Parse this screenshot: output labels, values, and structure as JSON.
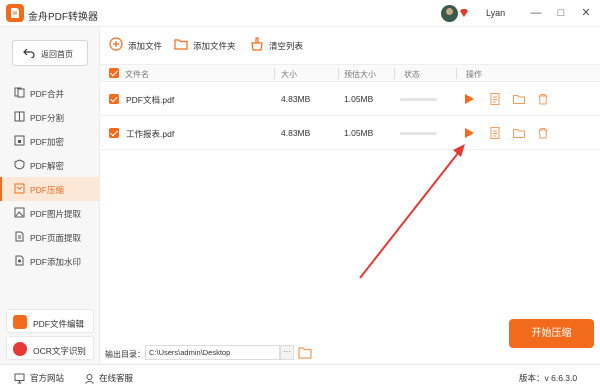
{
  "app": {
    "title": "金舟PDF转换器",
    "brand_color": "#f26b1d"
  },
  "user": {
    "name": "Lyan"
  },
  "window_buttons": [
    "—",
    "□",
    "✕"
  ],
  "sidebar": {
    "home_label": "返回首页",
    "items": [
      {
        "label": "PDF合并",
        "icon": "merge-icon"
      },
      {
        "label": "PDF分割",
        "icon": "split-icon"
      },
      {
        "label": "PDF加密",
        "icon": "lock-icon"
      },
      {
        "label": "PDF解密",
        "icon": "unlock-icon"
      },
      {
        "label": "PDF压缩",
        "icon": "compress-icon",
        "active": true
      },
      {
        "label": "PDF图片提取",
        "icon": "image-icon"
      },
      {
        "label": "PDF页面提取",
        "icon": "page-icon"
      },
      {
        "label": "PDF添加水印",
        "icon": "watermark-icon"
      }
    ],
    "tools": [
      {
        "label": "PDF文件编辑",
        "icon": "pdf-edit-icon",
        "color": "#f26b1d"
      },
      {
        "label": "OCR文字识别",
        "icon": "ocr-icon",
        "color": "#e53935"
      }
    ]
  },
  "toolbar": {
    "add_file": "添加文件",
    "add_folder": "添加文件夹",
    "clear_list": "清空列表"
  },
  "table": {
    "headers": {
      "name": "文件名",
      "size": "大小",
      "estimated": "预估大小",
      "status": "状态",
      "actions": "操作"
    },
    "rows": [
      {
        "name": "PDF文档.pdf",
        "size": "4.83MB",
        "estimated": "1.05MB",
        "progress": 0
      },
      {
        "name": "工作报表.pdf",
        "size": "4.83MB",
        "estimated": "1.05MB",
        "progress": 0
      }
    ]
  },
  "output": {
    "label": "输出目录：",
    "path": "C:\\Users\\admin\\Desktop",
    "browse": "···"
  },
  "start_button": "开始压缩",
  "statusbar": {
    "website": "官方网站",
    "service": "在线客服",
    "version": "版本：v 6.6.3.0"
  }
}
